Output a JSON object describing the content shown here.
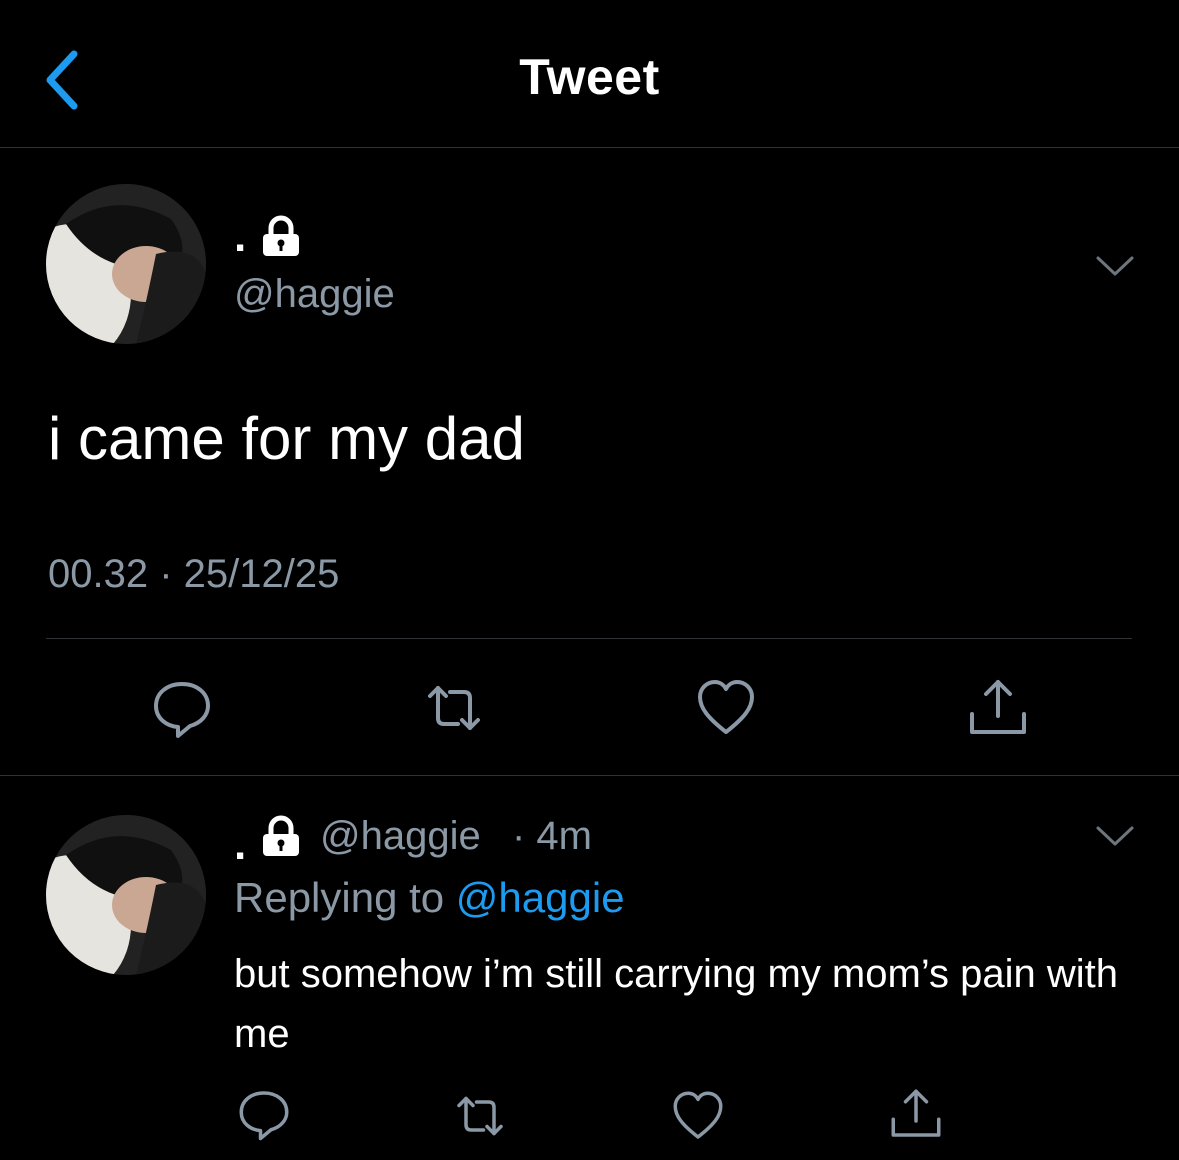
{
  "header": {
    "title": "Tweet"
  },
  "tweet": {
    "display_name": ".",
    "handle": "@haggie",
    "text": "i came for my dad",
    "timestamp": "00.32 · 25/12/25"
  },
  "reply": {
    "display_name": ".",
    "handle": "@haggie",
    "time": "· 4m",
    "replying_prefix": "Replying to",
    "replying_handle": "@haggie",
    "text": "but somehow i’m still carrying my mom’s pain with me"
  },
  "icons": {
    "back": "chevron-left-icon",
    "lock": "lock-icon",
    "more": "chevron-down-icon",
    "reply": "speech-bubble-icon",
    "retweet": "retweet-icon",
    "like": "heart-icon",
    "share": "share-icon"
  },
  "colors": {
    "accent": "#1d9bf0",
    "secondary": "#8b98a5",
    "divider": "#2f3336",
    "background": "#000000"
  }
}
